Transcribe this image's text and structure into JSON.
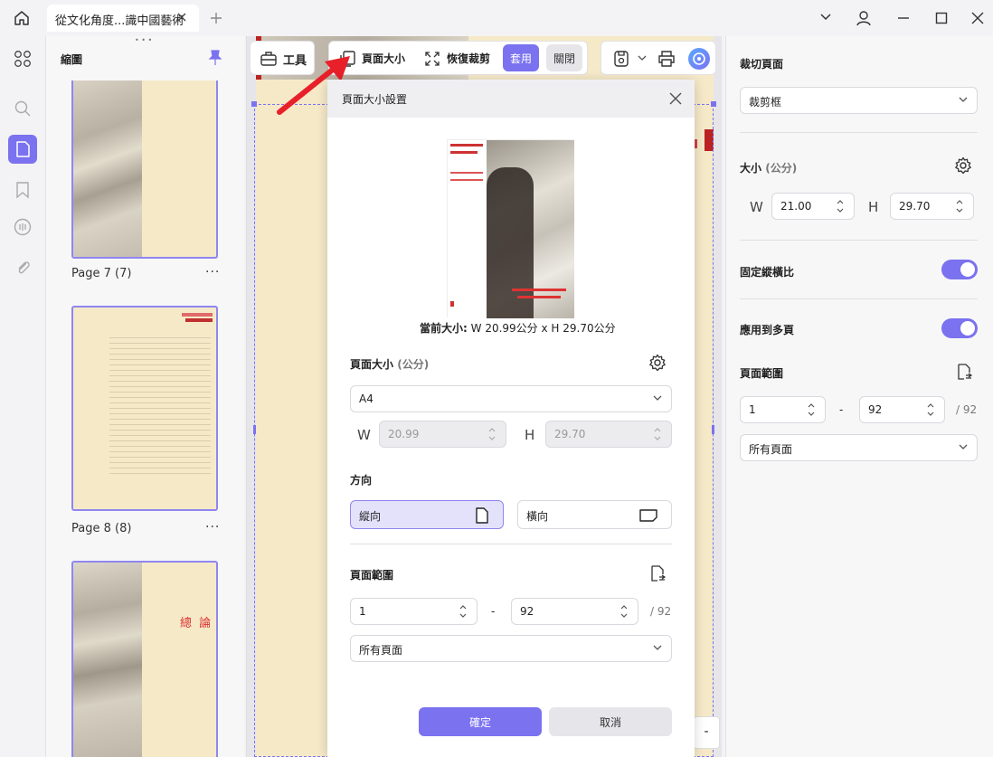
{
  "window": {
    "tab_title": "從文化角度...識中國藝術",
    "icons": [
      "home-icon",
      "close-tab-icon",
      "new-tab-icon",
      "chevron-down-icon",
      "user-icon",
      "minimize-icon",
      "maximize-icon",
      "close-window-icon"
    ]
  },
  "sidebar": {
    "panel_title": "縮圖",
    "handle": "• • •",
    "rail_icons": [
      "thumbnails-icon",
      "search-icon",
      "page-icon",
      "bookmark-icon",
      "comment-icon",
      "attachment-icon"
    ],
    "pages": [
      {
        "label": "Page 7 (7)",
        "more": "···"
      },
      {
        "label": "Page 8 (8)",
        "more": "···"
      },
      {
        "label": "總 論"
      }
    ]
  },
  "toolbar": {
    "tools_label": "工具",
    "page_size_label": "頁面大小",
    "restore_crop_label": "恢復裁剪",
    "apply_label": "套用",
    "close_label": "關閉"
  },
  "dialog": {
    "title": "頁面大小設置",
    "current_size_label": "當前大小:",
    "current_size_value": "W 20.99公分 x H 29.70公分",
    "page_size_label": "頁面大小",
    "page_size_unit": "(公分)",
    "preset": "A4",
    "w_label": "W",
    "w_value": "20.99",
    "h_label": "H",
    "h_value": "29.70",
    "orientation_label": "方向",
    "portrait_label": "縱向",
    "landscape_label": "橫向",
    "range_label": "頁面範圍",
    "range_from": "1",
    "range_dash": "-",
    "range_to": "92",
    "range_total": "/ 92",
    "range_option": "所有頁面",
    "ok_label": "確定",
    "cancel_label": "取消"
  },
  "right_panel": {
    "crop_title": "裁切頁面",
    "crop_box": "裁剪框",
    "size_label": "大小",
    "size_unit": "(公分)",
    "w_label": "W",
    "w_value": "21.00",
    "h_label": "H",
    "h_value": "29.70",
    "fix_ratio_label": "固定縱橫比",
    "fix_ratio_on": true,
    "apply_multi_label": "應用到多頁",
    "apply_multi_on": true,
    "range_label": "頁面範圍",
    "range_from": "1",
    "range_dash": "-",
    "range_to": "92",
    "range_total": "/ 92",
    "range_option": "所有頁面"
  },
  "colors": {
    "accent": "#7b72f0",
    "arrow": "#e8202a",
    "page": "#f5e9c8",
    "selected_bg": "#e4e2fb"
  }
}
